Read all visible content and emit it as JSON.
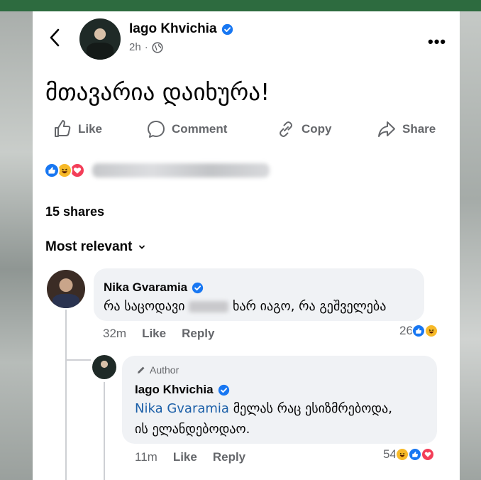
{
  "post": {
    "author_name": "Iago Khvichia",
    "time": "2h",
    "privacy_icon": "globe-icon",
    "text": "მთავარია დაიხურა!"
  },
  "actions": {
    "like_label": "Like",
    "comment_label": "Comment",
    "copy_label": "Copy",
    "share_label": "Share"
  },
  "stats": {
    "shares": "15 shares"
  },
  "comments_sort": {
    "label": "Most relevant"
  },
  "comments": [
    {
      "author": "Nika Gvaramia",
      "text_before": "რა საცოდავი",
      "text_after": "ხარ იაგო, რა გეშველება",
      "time": "32m",
      "like_label": "Like",
      "reply_label": "Reply",
      "reaction_count": "26"
    }
  ],
  "reply": {
    "badge": "Author",
    "author": "Iago Khvichia",
    "mention": "Nika Gvaramia",
    "text_line1": "მელას რაც ესიზმრებოდა,",
    "text_line2": "ის ელანდებოდაო.",
    "time": "11m",
    "like_label": "Like",
    "reply_label": "Reply",
    "reaction_count": "54"
  },
  "colors": {
    "facebook_blue": "#1877f2",
    "haha_yellow": "#f7b928",
    "love_red": "#f33e58",
    "secondary_text": "#65676b"
  }
}
